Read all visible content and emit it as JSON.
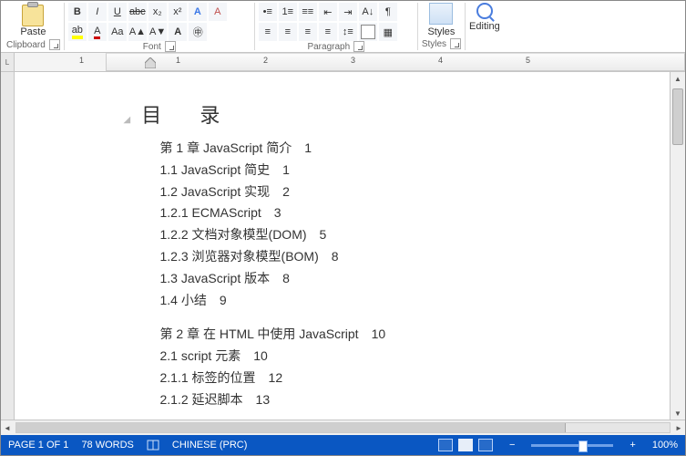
{
  "ribbon": {
    "clipboard": {
      "paste": "Paste",
      "label": "Clipboard"
    },
    "font": {
      "label": "Font"
    },
    "paragraph": {
      "label": "Paragraph"
    },
    "styles": {
      "btn": "Styles",
      "label": "Styles"
    },
    "editing": {
      "btn": "Editing"
    }
  },
  "ruler": {
    "left": "L",
    "numbers": [
      "1",
      "1",
      "2",
      "3",
      "4",
      "5"
    ]
  },
  "document": {
    "title": "目  录",
    "lines": [
      {
        "t": "第 1 章   JavaScript 简介",
        "p": "1"
      },
      {
        "t": "1.1   JavaScript 简史",
        "p": "1"
      },
      {
        "t": "1.2   JavaScript 实现",
        "p": "2"
      },
      {
        "t": "1.2.1   ECMAScript",
        "p": "3"
      },
      {
        "t": "1.2.2   文档对象模型(DOM)",
        "p": "5"
      },
      {
        "t": "1.2.3   浏览器对象模型(BOM)",
        "p": "8"
      },
      {
        "t": "1.3   JavaScript 版本",
        "p": "8"
      },
      {
        "t": "1.4   小结",
        "p": "9"
      },
      {
        "spacer": true
      },
      {
        "t": "第 2 章   在 HTML 中使用 JavaScript",
        "p": "10"
      },
      {
        "t": "2.1   script 元素",
        "p": "10"
      },
      {
        "t": "2.1.1   标签的位置",
        "p": "12"
      },
      {
        "t": "2.1.2   延迟脚本",
        "p": "13"
      }
    ]
  },
  "status": {
    "page": "PAGE 1 OF 1",
    "words": "78 WORDS",
    "lang": "CHINESE (PRC)",
    "zoom": "100%",
    "minus": "−",
    "plus": "+"
  }
}
